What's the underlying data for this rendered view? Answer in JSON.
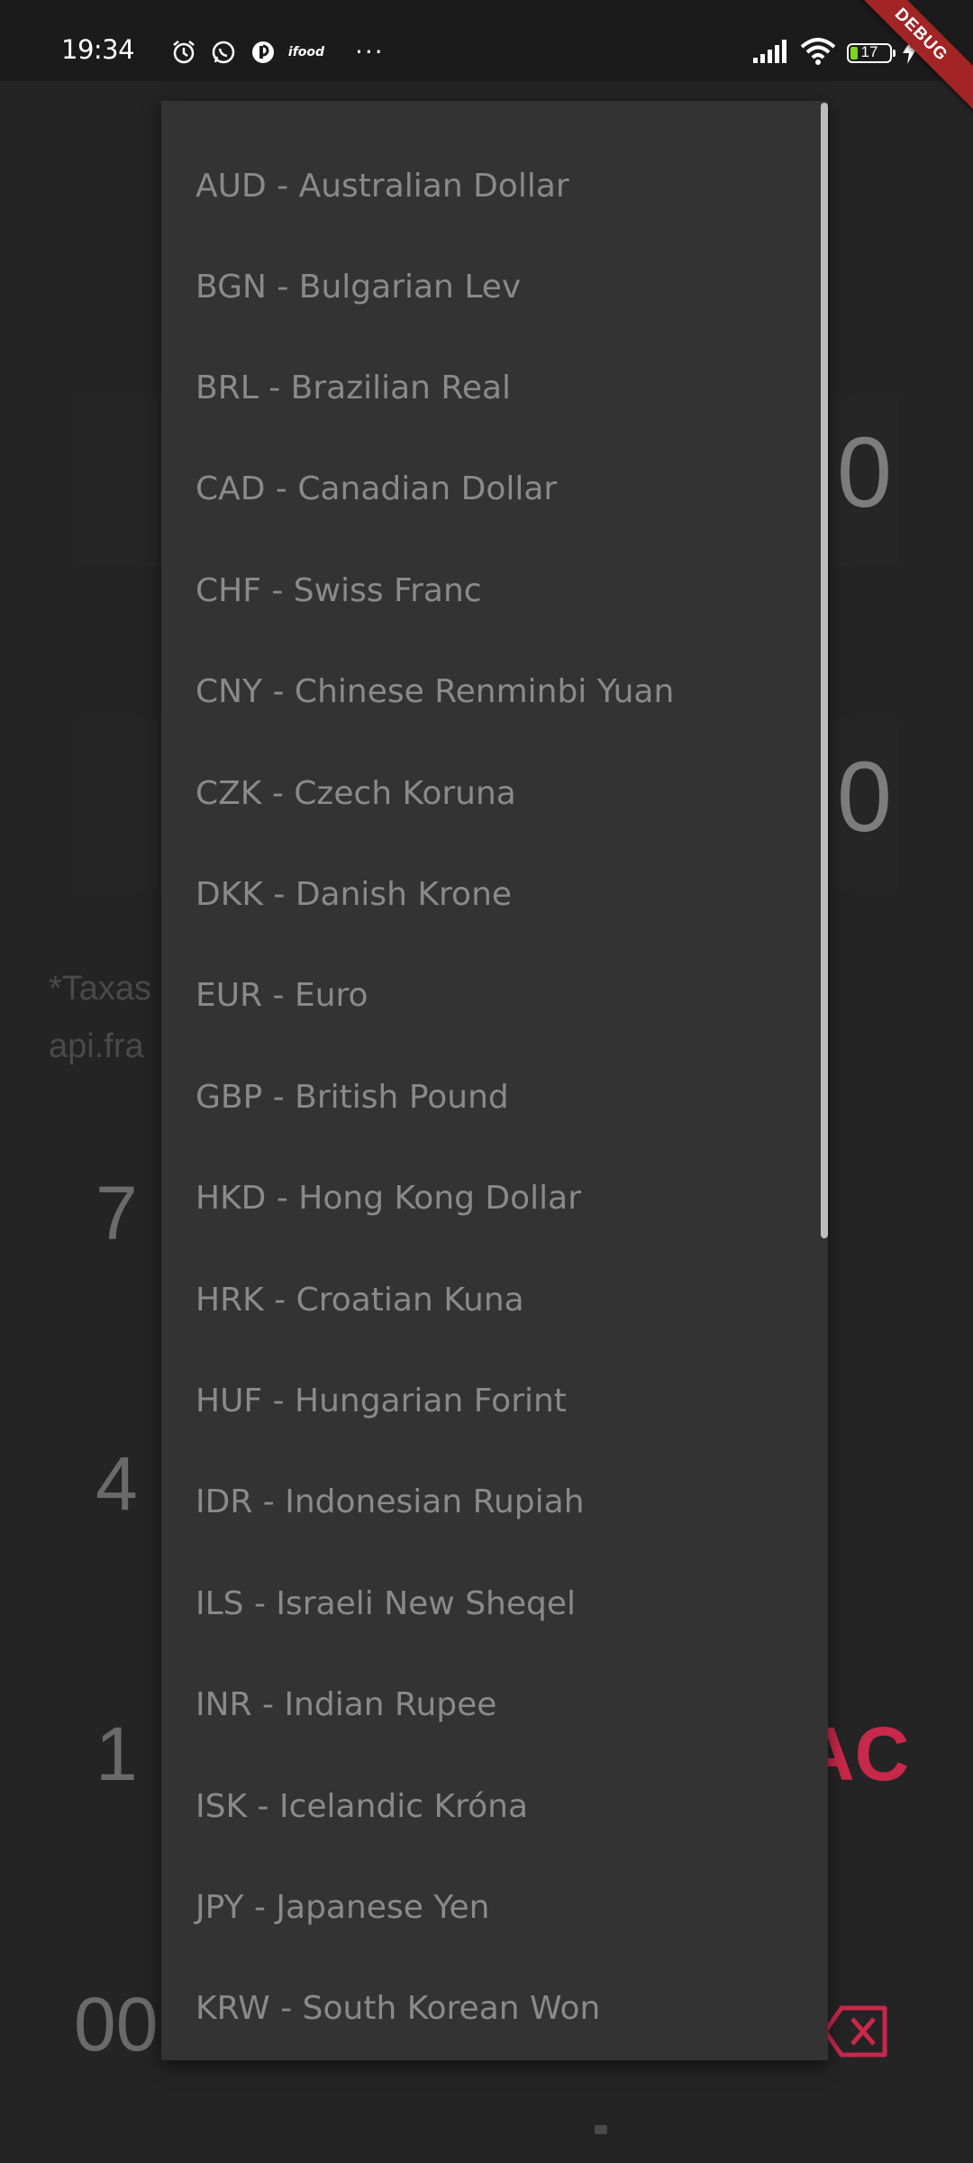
{
  "status_bar": {
    "time": "19:34",
    "battery_level": "17",
    "icons_left": [
      "alarm-icon",
      "whatsapp-icon",
      "app-icon",
      "ifood-icon",
      "more-dots-icon"
    ],
    "ifood_label": "ifood",
    "icons_right": [
      "signal-icon",
      "wifi-icon",
      "battery-icon",
      "charging-icon"
    ]
  },
  "debug_banner": "DEBUG",
  "background": {
    "top_value": "0",
    "bottom_value": "0",
    "footnote_line1": "*Taxas",
    "footnote_line2": "api.fra",
    "keys": {
      "k7": "7",
      "k4": "4",
      "k1": "1",
      "k00": "00",
      "ac": "AC"
    }
  },
  "dropdown": {
    "items": [
      "AUD - Australian Dollar",
      "BGN - Bulgarian Lev",
      "BRL - Brazilian Real",
      "CAD - Canadian Dollar",
      "CHF - Swiss Franc",
      "CNY - Chinese Renminbi Yuan",
      "CZK - Czech Koruna",
      "DKK - Danish Krone",
      "EUR - Euro",
      "GBP - British Pound",
      "HKD - Hong Kong Dollar",
      "HRK - Croatian Kuna",
      "HUF - Hungarian Forint",
      "IDR - Indonesian Rupiah",
      "ILS - Israeli New Sheqel",
      "INR - Indian Rupee",
      "ISK - Icelandic Króna",
      "JPY - Japanese Yen",
      "KRW - South Korean Won"
    ]
  },
  "colors": {
    "accent_red": "#c8284a",
    "menu_bg": "#333333",
    "screen_bg": "#242424"
  }
}
